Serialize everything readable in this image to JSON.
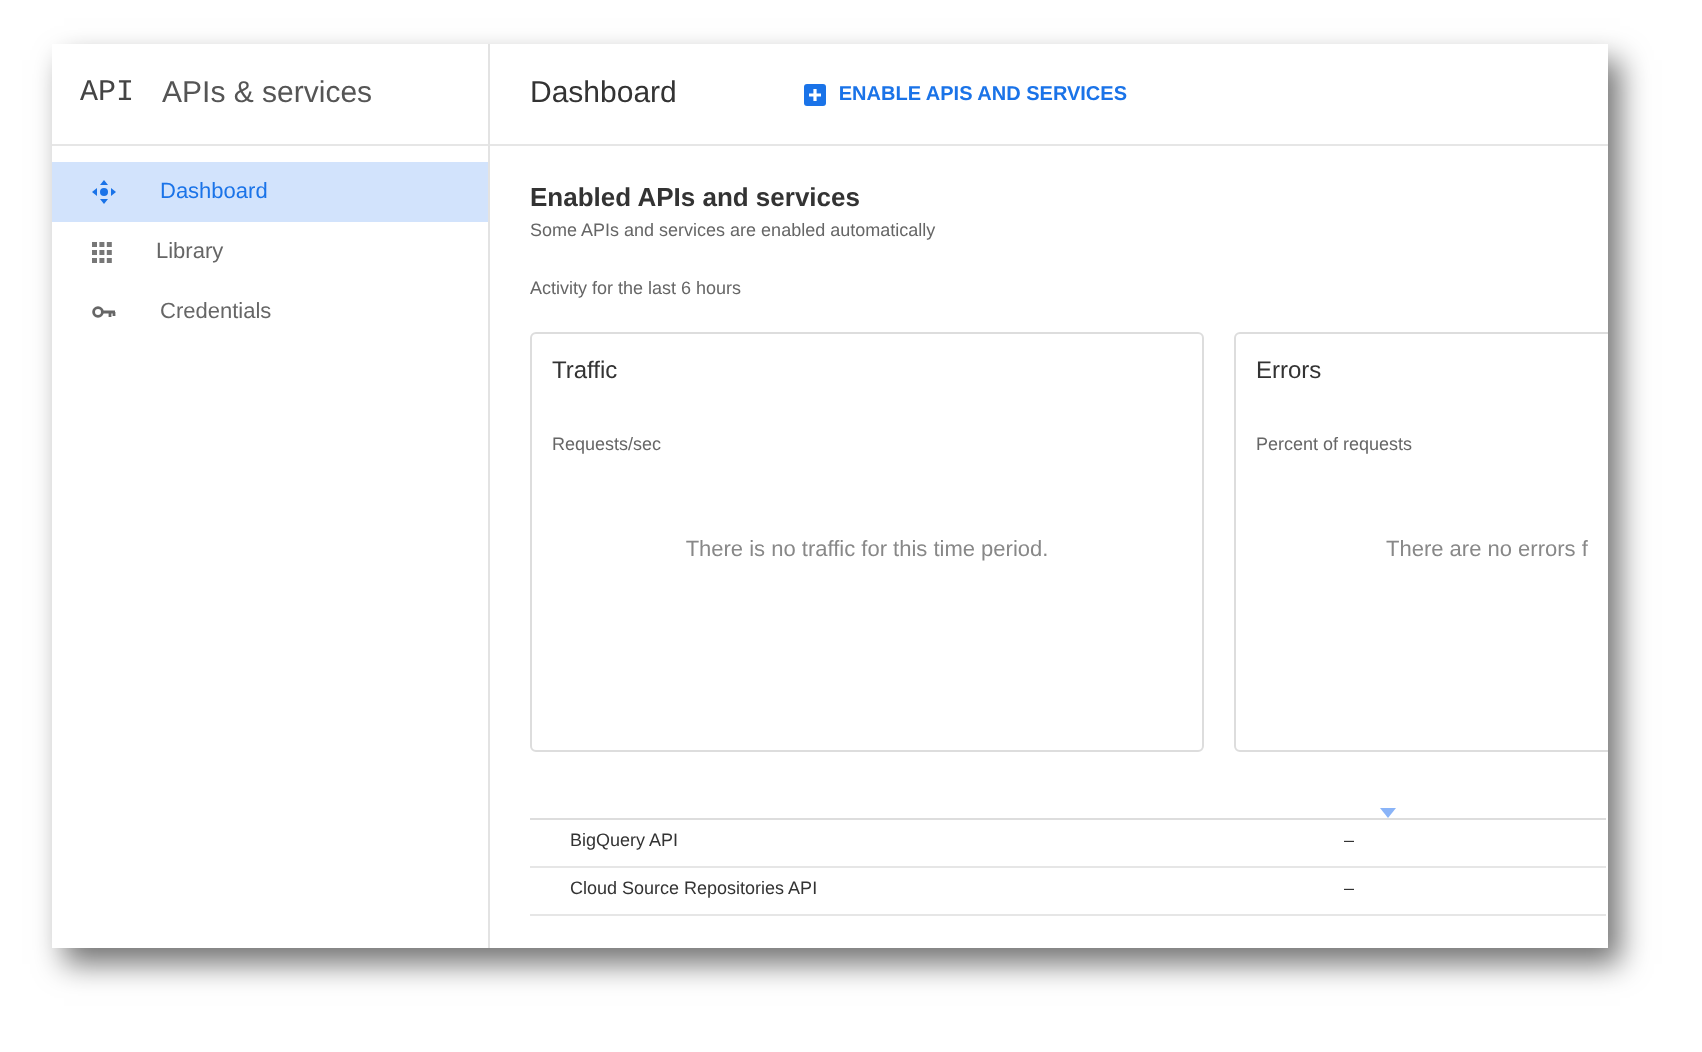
{
  "sidebar": {
    "logo": "API",
    "title": "APIs & services",
    "items": [
      {
        "label": "Dashboard",
        "kind": "dashboard",
        "selected": true
      },
      {
        "label": "Library",
        "kind": "library",
        "selected": false
      },
      {
        "label": "Credentials",
        "kind": "credentials",
        "selected": false
      }
    ]
  },
  "header": {
    "title": "Dashboard",
    "action": "ENABLE APIS AND SERVICES"
  },
  "section": {
    "title": "Enabled APIs and services",
    "subtitle": "Some APIs and services are enabled automatically",
    "activity": "Activity for the last 6 hours"
  },
  "cards": [
    {
      "title": "Traffic",
      "metric": "Requests/sec",
      "message": "There is no traffic for this time period."
    },
    {
      "title": "Errors",
      "metric": "Percent of requests",
      "message": "There are no errors f"
    }
  ],
  "table": {
    "rows": [
      {
        "name": "BigQuery API",
        "column_2": "–"
      },
      {
        "name": "Cloud Source Repositories API",
        "column_2": "–"
      }
    ]
  }
}
